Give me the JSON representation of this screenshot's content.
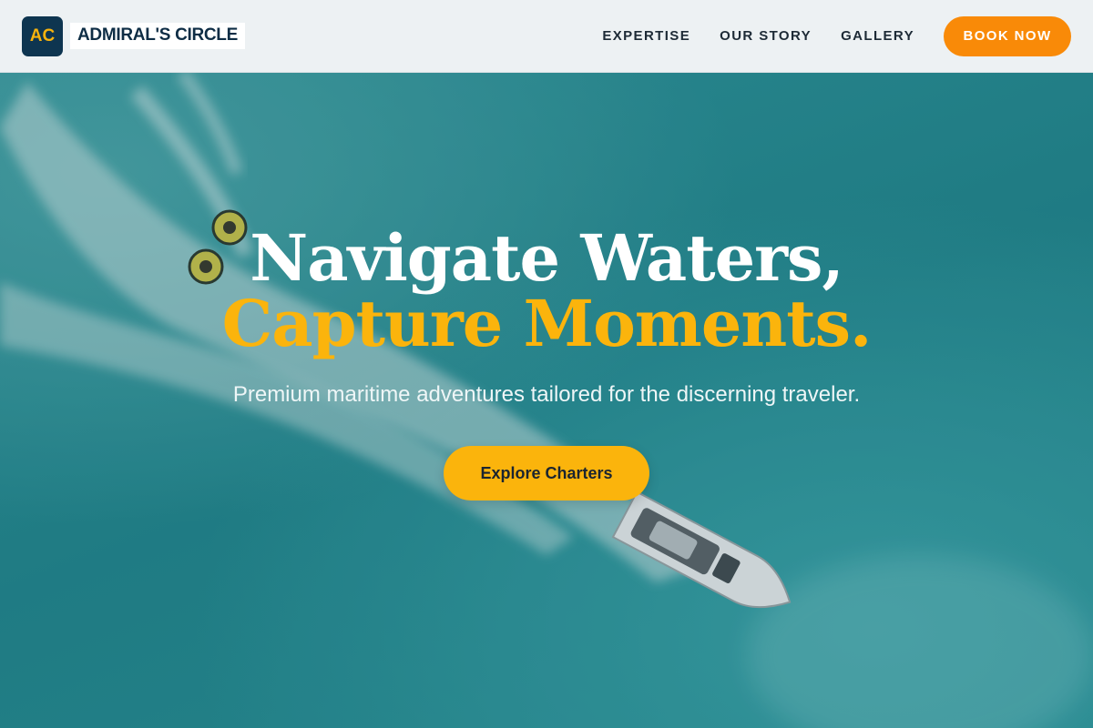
{
  "header": {
    "logo_initials": "AC",
    "brand_name": "ADMIRAL'S CIRCLE",
    "nav": [
      {
        "label": "EXPERTISE"
      },
      {
        "label": "OUR STORY"
      },
      {
        "label": "GALLERY"
      }
    ],
    "cta_label": "BOOK NOW"
  },
  "hero": {
    "headline_line1": "Navigate Waters,",
    "headline_line2": "Capture Moments.",
    "subtitle": "Premium maritime adventures tailored for the discerning traveler.",
    "cta_label": "Explore Charters"
  },
  "colors": {
    "navy": "#0e3550",
    "gold": "#fbb40c",
    "orange": "#f98a08",
    "sea": "#2a8f96"
  }
}
